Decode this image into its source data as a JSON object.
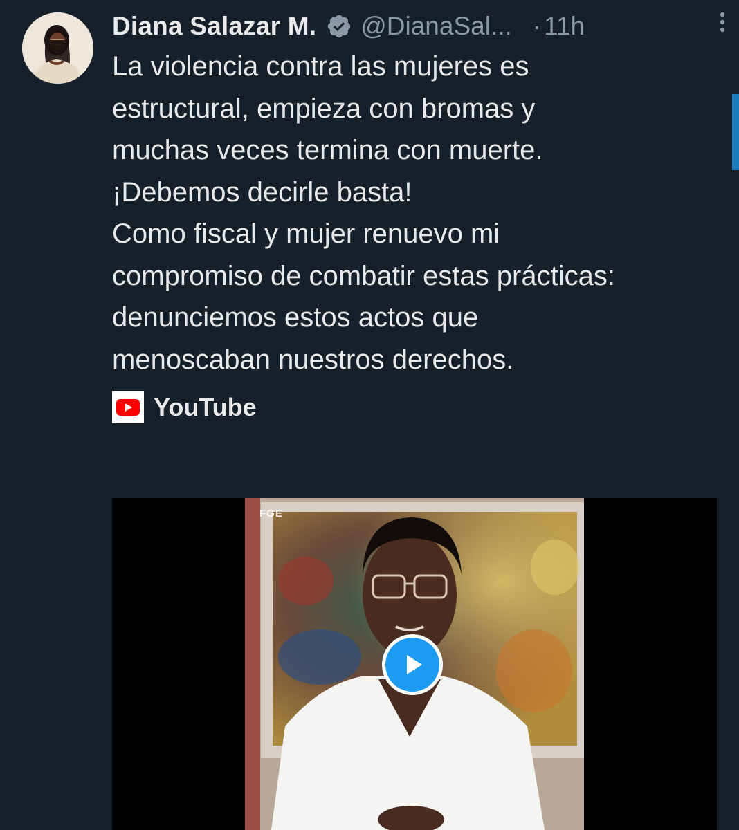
{
  "tweet": {
    "display_name": "Diana Salazar M.",
    "handle": "@DianaSal...",
    "separator": "·",
    "time": "11h",
    "text": "La violencia contra las mujeres es\nestructural, empieza con bromas y\nmuchas veces termina con muerte.\n¡Debemos decirle basta!\nComo fiscal y mujer renuevo mi\ncompromiso de combatir estas prácticas:\ndenunciemos estos actos que\nmenoscaban nuestros derechos.",
    "source_label": "YouTube",
    "media": {
      "watermark": "FGE"
    }
  },
  "colors": {
    "background": "#15202b",
    "text": "#e7e9ea",
    "secondary": "#8b98a5",
    "accent": "#1d9bf0",
    "youtube_red": "#ff0000"
  },
  "icons": {
    "verified": "verified-badge-icon",
    "more": "more-options-icon",
    "youtube": "youtube-icon",
    "play": "play-icon"
  }
}
